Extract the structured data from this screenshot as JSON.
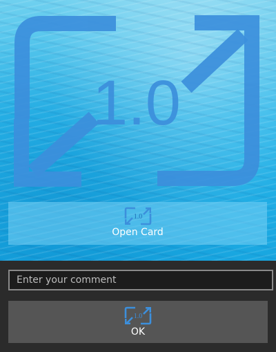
{
  "hero": {
    "icon": "card-version-icon",
    "icon_text": "1.0",
    "icon_color": "#3c8fdc"
  },
  "open_card": {
    "icon": "card-version-icon",
    "icon_text": "1.0",
    "label": "Open Card"
  },
  "comment": {
    "placeholder": "Enter your comment",
    "value": ""
  },
  "ok_button": {
    "icon": "card-version-icon",
    "icon_text": "1.0",
    "label": "OK"
  },
  "colors": {
    "accent": "#3c8fdc",
    "panel_bg": "#2b2b2b",
    "button_bg": "#555555",
    "input_border": "#8a8a8a"
  }
}
